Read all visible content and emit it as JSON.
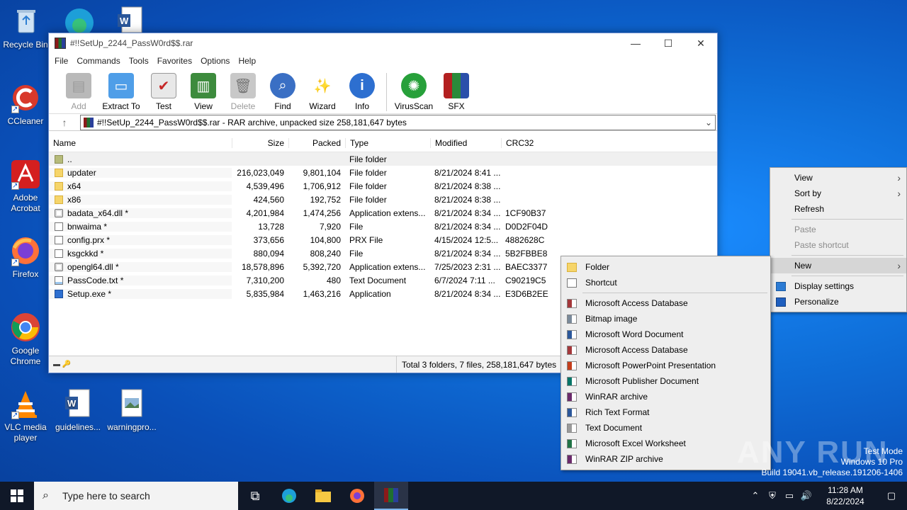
{
  "desktop": {
    "icons": [
      {
        "label": "Recycle Bin",
        "icon": "recycle-bin-icon"
      },
      {
        "label": "CCleaner",
        "icon": "ccleaner-icon"
      },
      {
        "label": "Adobe Acrobat",
        "icon": "adobe-acrobat-icon"
      },
      {
        "label": "Firefox",
        "icon": "firefox-icon"
      },
      {
        "label": "Google Chrome",
        "icon": "chrome-icon"
      },
      {
        "label": "VLC media player",
        "icon": "vlc-icon"
      },
      {
        "label": "guidelines...",
        "icon": "word-doc-icon"
      },
      {
        "label": "warningpro...",
        "icon": "image-file-icon"
      }
    ]
  },
  "winrar": {
    "title": "#!!SetUp_2244_PassW0rd$$.rar",
    "menu": [
      "File",
      "Commands",
      "Tools",
      "Favorites",
      "Options",
      "Help"
    ],
    "toolbar": [
      {
        "label": "Add",
        "icon": "add-archive-icon",
        "disabled": true
      },
      {
        "label": "Extract To",
        "icon": "extract-folder-icon"
      },
      {
        "label": "Test",
        "icon": "test-clipboard-icon"
      },
      {
        "label": "View",
        "icon": "view-book-icon"
      },
      {
        "label": "Delete",
        "icon": "trash-icon",
        "disabled": true
      },
      {
        "label": "Find",
        "icon": "magnifier-icon"
      },
      {
        "label": "Wizard",
        "icon": "wand-icon"
      },
      {
        "label": "Info",
        "icon": "info-icon"
      },
      {
        "label": "VirusScan",
        "icon": "virus-scan-icon"
      },
      {
        "label": "SFX",
        "icon": "sfx-box-icon"
      }
    ],
    "address": "#!!SetUp_2244_PassW0rd$$.rar - RAR archive, unpacked size 258,181,647 bytes",
    "columns": {
      "name": "Name",
      "size": "Size",
      "packed": "Packed",
      "type": "Type",
      "modified": "Modified",
      "crc": "CRC32"
    },
    "files": [
      {
        "name": "..",
        "size": "",
        "packed": "",
        "type": "File folder",
        "modified": "",
        "crc": "",
        "kind": "folderup"
      },
      {
        "name": "updater",
        "size": "216,023,049",
        "packed": "9,801,104",
        "type": "File folder",
        "modified": "8/21/2024 8:41 ...",
        "crc": "",
        "kind": "folder"
      },
      {
        "name": "x64",
        "size": "4,539,496",
        "packed": "1,706,912",
        "type": "File folder",
        "modified": "8/21/2024 8:38 ...",
        "crc": "",
        "kind": "folder"
      },
      {
        "name": "x86",
        "size": "424,560",
        "packed": "192,752",
        "type": "File folder",
        "modified": "8/21/2024 8:38 ...",
        "crc": "",
        "kind": "folder"
      },
      {
        "name": "badata_x64.dll *",
        "size": "4,201,984",
        "packed": "1,474,256",
        "type": "Application extens...",
        "modified": "8/21/2024 8:34 ...",
        "crc": "1CF90B37",
        "kind": "dll"
      },
      {
        "name": "bnwaima *",
        "size": "13,728",
        "packed": "7,920",
        "type": "File",
        "modified": "8/21/2024 8:34 ...",
        "crc": "D0D2F04D",
        "kind": "file"
      },
      {
        "name": "config.prx *",
        "size": "373,656",
        "packed": "104,800",
        "type": "PRX File",
        "modified": "4/15/2024 12:5...",
        "crc": "4882628C",
        "kind": "file"
      },
      {
        "name": "ksgckkd *",
        "size": "880,094",
        "packed": "808,240",
        "type": "File",
        "modified": "8/21/2024 8:34 ...",
        "crc": "5B2FBBE8",
        "kind": "file"
      },
      {
        "name": "opengl64.dll *",
        "size": "18,578,896",
        "packed": "5,392,720",
        "type": "Application extens...",
        "modified": "7/25/2023 2:31 ...",
        "crc": "BAEC3377",
        "kind": "dll"
      },
      {
        "name": "PassCode.txt *",
        "size": "7,310,200",
        "packed": "480",
        "type": "Text Document",
        "modified": "6/7/2024 7:11 ...",
        "crc": "C90219C5",
        "kind": "txt"
      },
      {
        "name": "Setup.exe *",
        "size": "5,835,984",
        "packed": "1,463,216",
        "type": "Application",
        "modified": "8/21/2024 8:34 ...",
        "crc": "E3D6B2EE",
        "kind": "exe"
      }
    ],
    "status": "Total 3 folders, 7 files, 258,181,647 bytes"
  },
  "context_menu": {
    "view": "View",
    "sort_by": "Sort by",
    "refresh": "Refresh",
    "paste": "Paste",
    "paste_shortcut": "Paste shortcut",
    "new": "New",
    "display_settings": "Display settings",
    "personalize": "Personalize"
  },
  "new_submenu": {
    "folder": "Folder",
    "shortcut": "Shortcut",
    "items": [
      {
        "label": "Microsoft Access Database",
        "color": "#a4373a"
      },
      {
        "label": "Bitmap image",
        "color": "#7a8a9a"
      },
      {
        "label": "Microsoft Word Document",
        "color": "#2b579a"
      },
      {
        "label": "Microsoft Access Database",
        "color": "#a4373a"
      },
      {
        "label": "Microsoft PowerPoint Presentation",
        "color": "#c43e1c"
      },
      {
        "label": "Microsoft Publisher Document",
        "color": "#077568"
      },
      {
        "label": "WinRAR archive",
        "color": "#6b2a6b"
      },
      {
        "label": "Rich Text Format",
        "color": "#2b579a"
      },
      {
        "label": "Text Document",
        "color": "#9a9a9a"
      },
      {
        "label": "Microsoft Excel Worksheet",
        "color": "#217346"
      },
      {
        "label": "WinRAR ZIP archive",
        "color": "#6b2a6b"
      }
    ]
  },
  "taskbar": {
    "search_placeholder": "Type here to search",
    "time": "11:28 AM",
    "date": "8/22/2024"
  },
  "watermark": {
    "line1": "Test Mode",
    "line2": "Windows 10 Pro",
    "line3": "Build 19041.vb_release.191206-1406",
    "brand": "ANY RUN"
  }
}
